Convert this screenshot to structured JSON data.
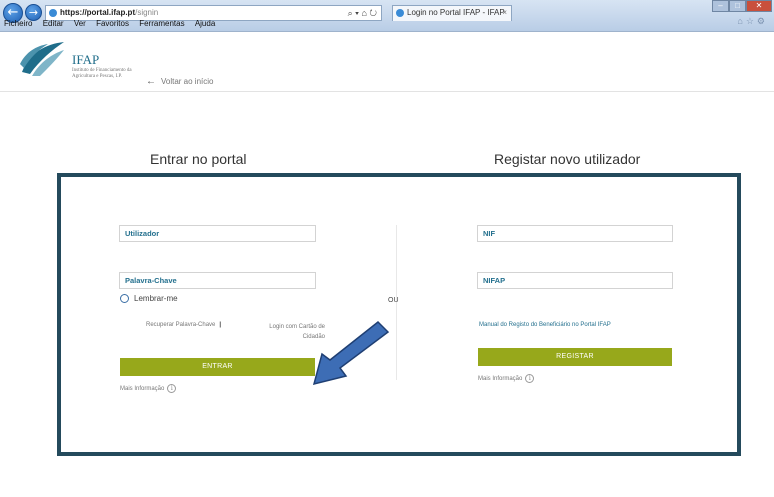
{
  "browser": {
    "url_host": "https://portal.ifap.pt",
    "url_path": "/signin",
    "address_tools": "⌕ ▾ ⌂ ↻",
    "tab_title": "Login no Portal IFAP - IFAP",
    "tab_close": "×",
    "menu": [
      "Ficheiro",
      "Editar",
      "Ver",
      "Favoritos",
      "Ferramentas",
      "Ajuda"
    ]
  },
  "header": {
    "logo_name": "IFAP",
    "logo_subtitle": "Instituto de Financiamento da Agricultura e Pescas, I.P."
  },
  "page": {
    "back_link": "Voltar ao início",
    "login_heading_bold": "Entrar",
    "login_heading_rest": " no portal",
    "register_heading_bold": "Registar",
    "register_heading_rest": " novo utilizador",
    "or_label": "OU"
  },
  "login": {
    "user_placeholder": "Utilizador",
    "password_placeholder": "Palavra-Chave",
    "remember_label": "Lembrar-me",
    "recover_link": "Recuperar Palavra-Chave",
    "separator": "|",
    "cc_link": "Login com Cartão de Cidadão",
    "enter_button": "ENTRAR",
    "more_info": "Mais Informação"
  },
  "register": {
    "nif_placeholder": "NIF",
    "nifap_placeholder": "NIFAP",
    "manual_link": "Manual do Registo do Beneficiário no Portal IFAP",
    "register_button": "REGISTAR",
    "more_info": "Mais Informação"
  },
  "colors": {
    "accent_green": "#97a81b",
    "frame_border": "#244a5c",
    "field_text": "#24708e",
    "annotation_arrow": "#3d6db5"
  }
}
